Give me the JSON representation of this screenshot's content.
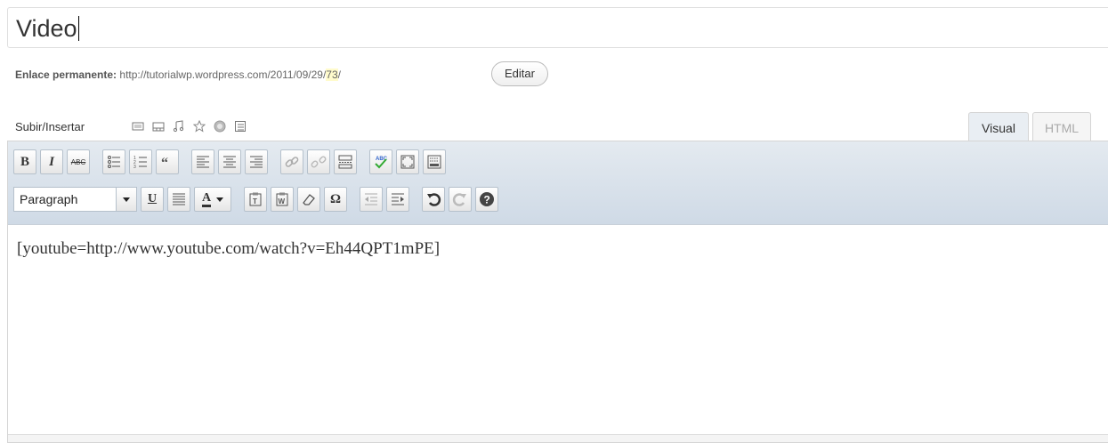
{
  "post": {
    "title": "Video",
    "permalink_label": "Enlace permanente:",
    "permalink_base": "http://tutorialwp.wordpress.com/2011/09/29/",
    "permalink_slug": "73",
    "permalink_tail": "/",
    "edit_label": "Editar"
  },
  "media": {
    "label": "Subir/Insertar",
    "icons": [
      "add-image-icon",
      "add-video-icon",
      "add-audio-icon",
      "add-poll-icon",
      "add-media-icon",
      "add-form-icon"
    ]
  },
  "tabs": {
    "visual": "Visual",
    "html": "HTML"
  },
  "toolbar": {
    "bold": "B",
    "italic": "I",
    "strike": "ABC",
    "format": "Paragraph",
    "underline": "U",
    "text_color": "A",
    "omega": "Ω"
  },
  "editor": {
    "content": "[youtube=http://www.youtube.com/watch?v=Eh44QPT1mPE]"
  },
  "colors": {
    "toolbar_top": "#e4eaf0",
    "toolbar_bottom": "#cfdae6",
    "slug_highlight": "#fffbcc"
  }
}
